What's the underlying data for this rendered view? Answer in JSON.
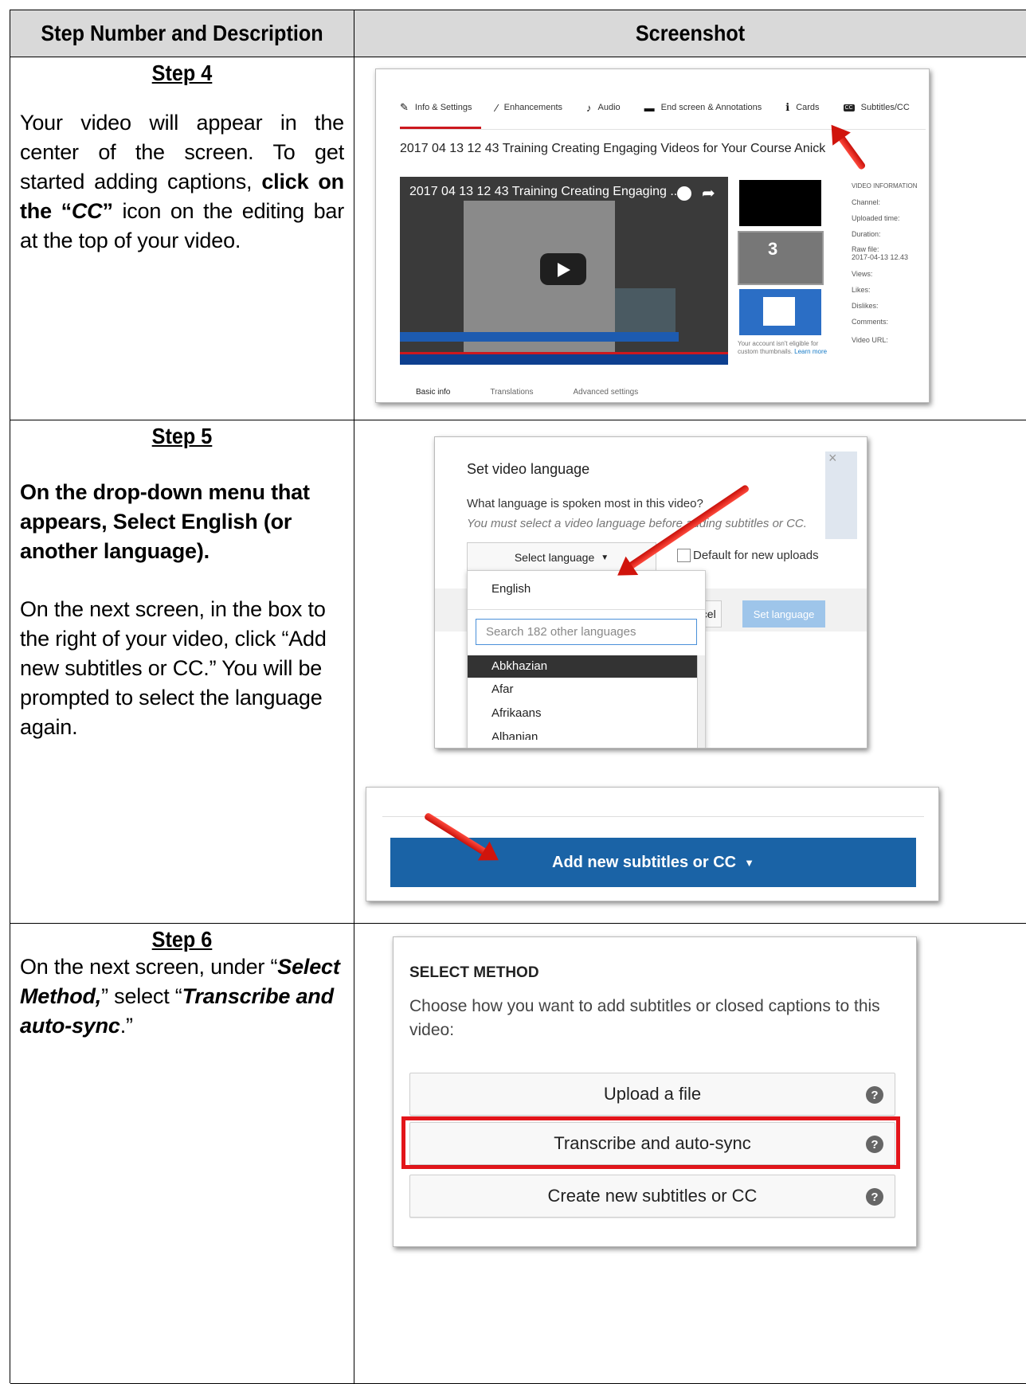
{
  "header": {
    "col1": "Step Number and Description",
    "col2": "Screenshot"
  },
  "step4": {
    "title": "Step 4",
    "text_a": "Your video will appear in the center of the screen. To get started adding captions, ",
    "text_bold": "click on the “",
    "text_bold_italic": "CC",
    "text_bold_close": "”",
    "text_b": " icon on the editing bar at the top of your video."
  },
  "step5": {
    "title": "Step 5",
    "bold_text": "On the drop-down menu that appears, Select English (or another language).",
    "text": "On the next screen, in the box to the right of your video, click “Add new subtitles or CC.” You will be prompted to select the language again."
  },
  "step6": {
    "t1": "On the next screen, under “",
    "t2": "Select Method,",
    "t3": "” select “",
    "t4": "Transcribe and auto-sync",
    "t5": ".”"
  },
  "youtube_editor": {
    "tabs": [
      {
        "label": "Info & Settings",
        "icon": "pencil-icon",
        "glyph": "✎"
      },
      {
        "label": "Enhancements",
        "icon": "magic-wand-icon",
        "glyph": "⁄"
      },
      {
        "label": "Audio",
        "icon": "music-note-icon",
        "glyph": "♪"
      },
      {
        "label": "End screen & Annotations",
        "icon": "end-screen-icon",
        "glyph": "▬"
      },
      {
        "label": "Cards",
        "icon": "info-icon",
        "glyph": "ℹ"
      },
      {
        "label": "Subtitles/CC",
        "icon": "cc-icon",
        "glyph": "CC"
      }
    ],
    "video_title": "2017 04 13 12 43 Training Creating Engaging Videos for Your Course Anick",
    "player_title": "2017 04 13 12 43 Training Creating Engaging ...",
    "thumb_number": "3",
    "thumb_note": "Your account isn't eligible for custom thumbnails. ",
    "learn_more": "Learn more",
    "info_heading": "VIDEO INFORMATION",
    "info_fields": [
      "Channel:",
      "Uploaded time:",
      "Duration:",
      "Raw file:",
      "2017-04-13 12.43",
      "Views:",
      "Likes:",
      "Dislikes:",
      "Comments:",
      "Video URL:"
    ],
    "bottom_tabs": [
      "Basic info",
      "Translations",
      "Advanced settings"
    ],
    "accent_color": "#cc181e",
    "link_color": "#167ac6"
  },
  "language_dialog": {
    "title": "Set video language",
    "question": "What language is spoken most in this video?",
    "hint": "You must select a video language before adding subtitles or CC.",
    "select_label": "Select language",
    "checkbox_label": "Default for new uploads",
    "cancel_partial": "ncel",
    "set_button": "Set language",
    "close": "×",
    "dropdown_first": "English",
    "search_placeholder": "Search 182 other languages",
    "languages": [
      "Abkhazian",
      "Afar",
      "Afrikaans",
      "Albanian"
    ]
  },
  "add_subtitles": {
    "button_label": "Add new subtitles or CC",
    "button_color": "#1a63a6"
  },
  "select_method": {
    "heading": "SELECT METHOD",
    "description": "Choose how you want to add subtitles or closed captions to this video:",
    "options": [
      "Upload a file",
      "Transcribe and auto-sync",
      "Create new subtitles or CC"
    ],
    "help_glyph": "?",
    "highlight_color": "#e3151a"
  }
}
